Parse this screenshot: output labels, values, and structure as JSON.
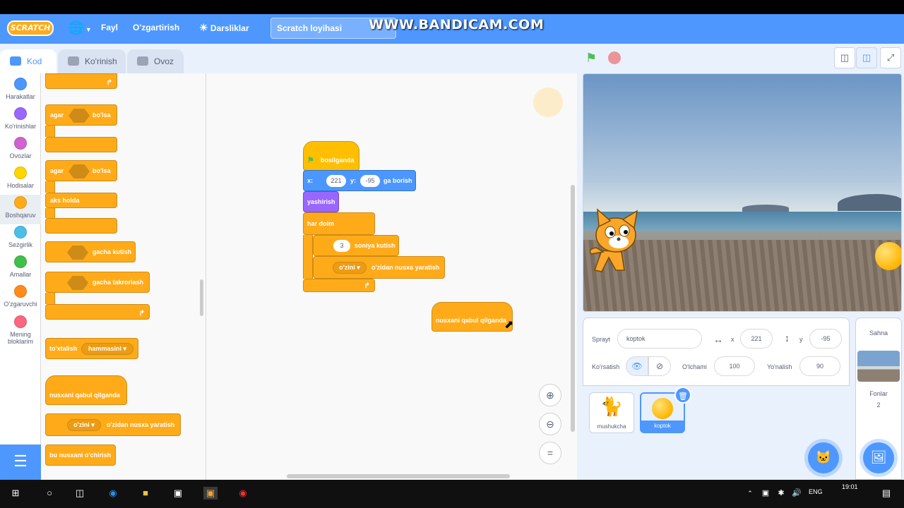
{
  "window": {
    "watermark": "WWW.BANDICAM.COM"
  },
  "menubar": {
    "logo": "SCRATCH",
    "file": "Fayl",
    "edit": "O'zgartirish",
    "tutorials": "Darsliklar",
    "project_title": "Scratch loyihasi"
  },
  "tabs": {
    "code": "Kod",
    "costumes": "Ko'rinish",
    "sounds": "Ovoz"
  },
  "categories": [
    {
      "label": "Harakatlar",
      "color": "#4c97ff"
    },
    {
      "label": "Ko'rinishlar",
      "color": "#9966ff"
    },
    {
      "label": "Ovozlar",
      "color": "#cf63cf"
    },
    {
      "label": "Hodisalar",
      "color": "#ffd500"
    },
    {
      "label": "Boshqaruv",
      "color": "#ffab19"
    },
    {
      "label": "Sezgirlik",
      "color": "#4cbfe6"
    },
    {
      "label": "Amallar",
      "color": "#40bf4a"
    },
    {
      "label": "O'zgaruvchi",
      "color": "#ff8c1a"
    },
    {
      "label": "Mening bloklarim",
      "color": "#ff6680"
    }
  ],
  "palette": {
    "if_then": {
      "a": "agar",
      "b": "bo'lsa"
    },
    "if_else": {
      "a": "agar",
      "b": "bo'lsa",
      "else": "aks holda"
    },
    "wait_until": "gacha kutish",
    "repeat_until": "gacha takrorlash",
    "stop": {
      "label": "to'xtalish",
      "option": "hammasini"
    },
    "clone_hat": "nusxani qabul qilganda",
    "create_clone": {
      "option": "o'zini",
      "label": "o'zidan nusxa yaratish"
    },
    "delete_clone": "bu nusxani o'chirish"
  },
  "script": {
    "hat": "bosilganda",
    "goto": {
      "x_label": "x:",
      "x": "221",
      "y_label": "y:",
      "y": "-95",
      "suffix": "ga borish"
    },
    "hide": "yashirish",
    "forever": "har doim",
    "wait": {
      "value": "3",
      "label": "soniya kutish"
    },
    "clone": {
      "option": "o'zini",
      "label": "o'zidan nusxa yaratish"
    },
    "dragged": "nusxani qabul qilganda"
  },
  "sprite_info": {
    "sprite_label": "Sprayt",
    "sprite_name": "koptok",
    "x_label": "x",
    "x": "221",
    "y_label": "y",
    "y": "-95",
    "show_label": "Ko'rsatish",
    "size_label": "O'lchami",
    "size": "100",
    "direction_label": "Yo'nalish",
    "direction": "90"
  },
  "sprites": [
    {
      "name": "mushukcha"
    },
    {
      "name": "koptok"
    }
  ],
  "stage_panel": {
    "title": "Sahna",
    "backdrops_label": "Fonlar",
    "backdrops_count": "2"
  },
  "taskbar": {
    "lang": "ENG",
    "time": "19:01"
  }
}
